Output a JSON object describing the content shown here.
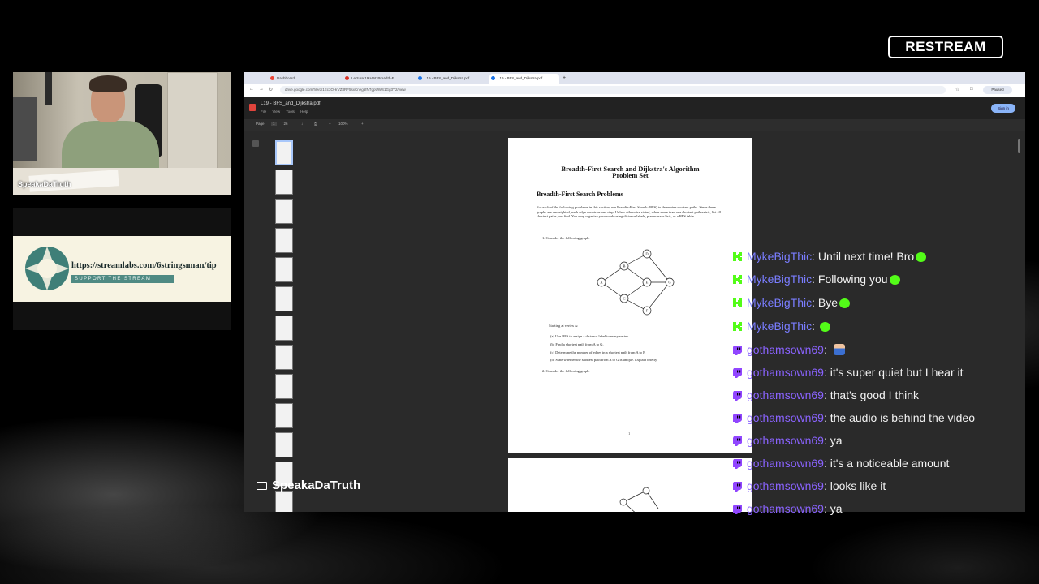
{
  "overlay": {
    "brand_logo": "RESTREAM",
    "webcam_name": "SpeakaDaTruth",
    "tip_url": "https://streamlabs.com/6stringsıman/tip",
    "tip_support": "SUPPORT THE STREAM",
    "streamer_name": "SpeakaDaTruth"
  },
  "browser": {
    "tabs": [
      {
        "label": "Dashboard",
        "color": "#ea4335"
      },
      {
        "label": "Lecture 19 HW: Breadth-F...",
        "color": "#d93025"
      },
      {
        "label": "L19 - BFS_and_Dijkstra.pdf",
        "color": "#1a73e8"
      },
      {
        "label": "L19 - BFS_and_Dijkstra.pdf",
        "color": "#1a73e8"
      }
    ],
    "url": "drive.google.com/file/d/1Ec3OHrVZ8RF5sxCneg6fNTgpUWS1Gg3Y2/view",
    "profile": "Paused",
    "pdf_title": "L19 - BFS_and_Dijkstra.pdf",
    "pdf_menu": "File View Tools Help",
    "signin": "Sign in",
    "toolbar": {
      "page_label": "Page",
      "page_num": "1",
      "page_total": "/ 26",
      "zoom": "100%"
    }
  },
  "document": {
    "title_line1": "Breadth-First Search and Dijkstra's Algorithm",
    "title_line2": "Problem Set",
    "section": "Breadth-First Search Problems",
    "intro": "For each of the following problems in this section, use Breadth-First Search (BFS) to determine shortest paths. Since these graphs are unweighted, each edge counts as one step. Unless otherwise stated, when more than one shortest path exists, list all shortest paths you find. You may organize your work using distance labels, predecessor lists, or a BFS table.",
    "q1": "1. Consider the following graph.",
    "start": "Starting at vertex A:",
    "parts": [
      "(a) Use BFS to assign a distance label to every vertex.",
      "(b) Find a shortest path from A to G.",
      "(c) Determine the number of edges in a shortest path from A to F.",
      "(d) State whether the shortest path from A to G is unique. Explain briefly."
    ],
    "q2": "2. Consider the following graph.",
    "page_number": "1",
    "graph_nodes": [
      "A",
      "B",
      "C",
      "D",
      "E",
      "F",
      "G"
    ]
  },
  "chat": {
    "messages": [
      {
        "platform": "kick",
        "user": "MykeBigThic",
        "text": "Until next time! Bro",
        "emote": "green"
      },
      {
        "platform": "kick",
        "user": "MykeBigThic",
        "text": "Following you",
        "emote": "green"
      },
      {
        "platform": "kick",
        "user": "MykeBigThic",
        "text": "Bye",
        "emote": "green"
      },
      {
        "platform": "kick",
        "user": "MykeBigThic",
        "text": "",
        "emote": "green"
      },
      {
        "platform": "twitch",
        "user": "gothamsown69",
        "text": "",
        "emote": "person"
      },
      {
        "platform": "twitch",
        "user": "gothamsown69",
        "text": "it's super quiet but I hear it",
        "emote": ""
      },
      {
        "platform": "twitch",
        "user": "gothamsown69",
        "text": "that's good I think",
        "emote": ""
      },
      {
        "platform": "twitch",
        "user": "gothamsown69",
        "text": "the audio is behind the video",
        "emote": ""
      },
      {
        "platform": "twitch",
        "user": "gothamsown69",
        "text": "ya",
        "emote": ""
      },
      {
        "platform": "twitch",
        "user": "gothamsown69",
        "text": "it's a noticeable amount",
        "emote": ""
      },
      {
        "platform": "twitch",
        "user": "gothamsown69",
        "text": "looks like it",
        "emote": ""
      },
      {
        "platform": "twitch",
        "user": "gothamsown69",
        "text": "ya",
        "emote": ""
      }
    ],
    "colors": {
      "kick": "#53fc18",
      "twitch": "#9146ff"
    }
  }
}
